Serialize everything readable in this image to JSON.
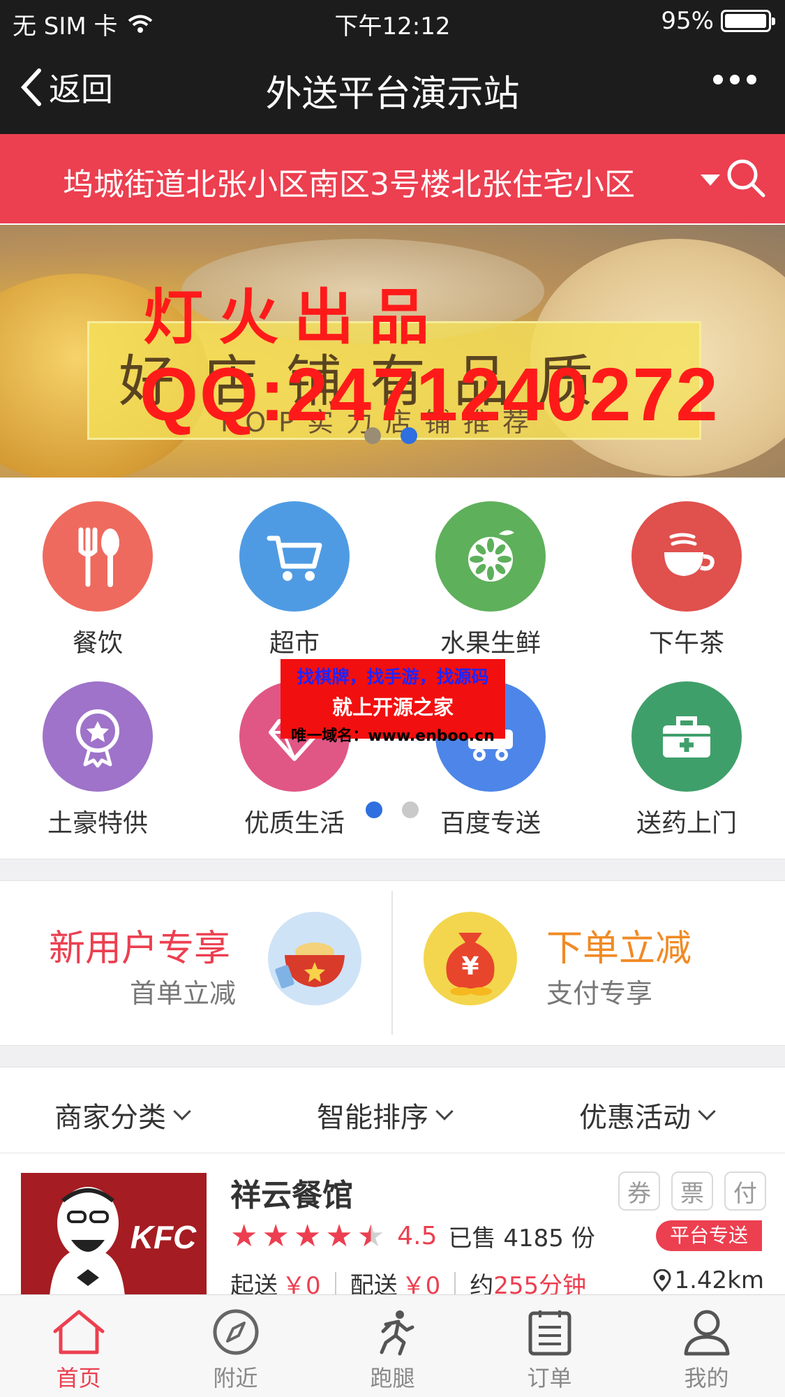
{
  "status_bar": {
    "carrier": "无 SIM 卡",
    "time": "下午12:12",
    "battery": "95%"
  },
  "nav": {
    "back_label": "返回",
    "title": "外送平台演示站"
  },
  "address": {
    "text": "坞城街道北张小区南区3号楼北张住宅小区"
  },
  "banner": {
    "headline": "好店铺有品质",
    "subline": "TOP实力店铺推荐",
    "watermark_line1": "灯火出品",
    "watermark_line2": "QQ:2471240272",
    "active_slide": 2,
    "slide_count": 2
  },
  "categories": [
    {
      "label": "餐饮",
      "icon": "fork-spoon-icon",
      "color": "#ef6a5e"
    },
    {
      "label": "超市",
      "icon": "shopping-cart-icon",
      "color": "#4f9be3"
    },
    {
      "label": "水果生鲜",
      "icon": "lime-slice-icon",
      "color": "#5eb05b"
    },
    {
      "label": "下午茶",
      "icon": "tea-cup-icon",
      "color": "#e0504d"
    },
    {
      "label": "土豪特供",
      "icon": "star-medal-icon",
      "color": "#9e73c9"
    },
    {
      "label": "优质生活",
      "icon": "diamond-icon",
      "color": "#e05785"
    },
    {
      "label": "百度专送",
      "icon": "delivery-cart-icon",
      "color": "#4d86e8"
    },
    {
      "label": "送药上门",
      "icon": "medicine-kit-icon",
      "color": "#3f9f6a"
    }
  ],
  "category_pager": {
    "active_page": 1,
    "page_count": 2
  },
  "ad_overlay": {
    "line1": "找棋牌，找手游，找源码",
    "line2": "就上开源之家",
    "line3": "唯一域名：www.enboo.cn"
  },
  "promos": [
    {
      "title": "新用户专享",
      "subtitle": "首单立减",
      "title_color": "#ec3f50"
    },
    {
      "title": "下单立减",
      "subtitle": "支付专享",
      "title_color": "#f08a24"
    }
  ],
  "filters": [
    {
      "label": "商家分类"
    },
    {
      "label": "智能排序"
    },
    {
      "label": "优惠活动"
    }
  ],
  "shop": {
    "name": "祥云餐馆",
    "logo_text": "KFC",
    "tags": [
      "券",
      "票",
      "付"
    ],
    "rating": "4.5",
    "rating_value": 4.5,
    "sold_prefix": "已售",
    "sold_count": "4185",
    "sold_unit": "份",
    "badge": "平台专送",
    "min_order_label": "起送",
    "min_order_value": "￥0",
    "delivery_fee_label": "配送",
    "delivery_fee_value": "￥0",
    "eta_prefix": "约",
    "eta_value": "255分钟",
    "distance": "1.42km"
  },
  "tabbar": [
    {
      "label": "首页",
      "icon": "home-icon",
      "active": true
    },
    {
      "label": "附近",
      "icon": "compass-icon",
      "active": false
    },
    {
      "label": "跑腿",
      "icon": "runner-icon",
      "active": false
    },
    {
      "label": "订单",
      "icon": "order-list-icon",
      "active": false
    },
    {
      "label": "我的",
      "icon": "user-icon",
      "active": false
    }
  ],
  "colors": {
    "brand_red": "#ec3f50",
    "nav_bg": "#1c1c1c",
    "accent_blue": "#2f6fe0"
  }
}
